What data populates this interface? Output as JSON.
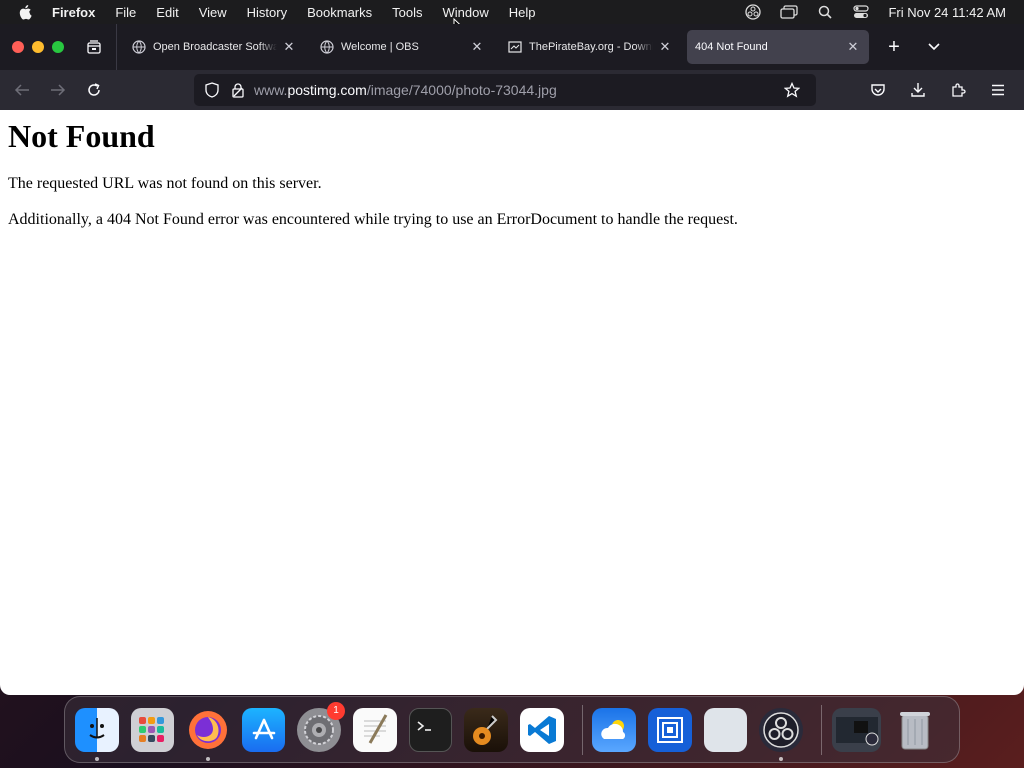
{
  "menubar": {
    "app_name": "Firefox",
    "items": [
      "File",
      "Edit",
      "View",
      "History",
      "Bookmarks",
      "Tools",
      "Window",
      "Help"
    ],
    "clock": "Fri Nov 24  11:42 AM"
  },
  "tabs": [
    {
      "title": "Open Broadcaster Software",
      "icon": "globe-icon",
      "active": false
    },
    {
      "title": "Welcome | OBS",
      "icon": "globe-icon",
      "active": false
    },
    {
      "title": "ThePirateBay.org - Download",
      "icon": "site-icon",
      "active": false
    },
    {
      "title": "404 Not Found",
      "icon": "none",
      "active": true
    }
  ],
  "urlbar": {
    "prefix": "www.",
    "host": "postimg.com",
    "path": "/image/74000/photo-73044.jpg"
  },
  "page": {
    "heading": "Not Found",
    "para1": "The requested URL was not found on this server.",
    "para2": "Additionally, a 404 Not Found error was encountered while trying to use an ErrorDocument to handle the request."
  },
  "dock": {
    "settings_badge": "1"
  },
  "colors": {
    "tabstrip": "#1c1b22",
    "navbar": "#2b2a33",
    "active_tab": "#42414d"
  }
}
